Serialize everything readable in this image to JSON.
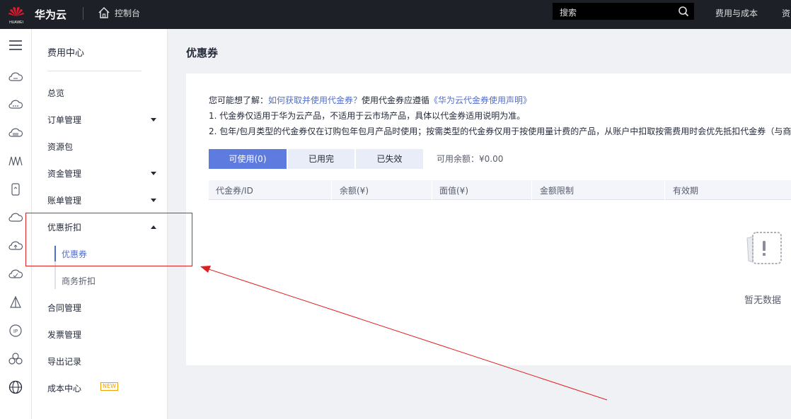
{
  "topbar": {
    "logo_text": "HUAWEI",
    "brand": "华为云",
    "console": "控制台",
    "search_placeholder": "搜索",
    "cost_link": "费用与成本",
    "more_link": "资"
  },
  "sidebar": {
    "title": "费用中心",
    "items": [
      {
        "label": "总览"
      },
      {
        "label": "订单管理",
        "expand": "down"
      },
      {
        "label": "资源包"
      },
      {
        "label": "资金管理",
        "expand": "down"
      },
      {
        "label": "账单管理",
        "expand": "down"
      },
      {
        "label": "优惠折扣",
        "expand": "up"
      },
      {
        "label": "合同管理"
      },
      {
        "label": "发票管理"
      },
      {
        "label": "导出记录"
      },
      {
        "label": "成本中心",
        "badge": "NEW"
      }
    ],
    "subitems": [
      {
        "label": "优惠券",
        "active": true
      },
      {
        "label": "商务折扣"
      }
    ]
  },
  "main": {
    "title": "优惠券",
    "tips": {
      "prefix": "您可能想了解：",
      "link1": "如何获取并使用代金券？",
      "mid": "使用代金券应遵循",
      "link2": "《华为云代金券使用声明》",
      "line1": "1. 代金券仅适用于华为云产品，不适用于云市场产品，具体以代金券适用说明为准。",
      "line2": "2. 包年/包月类型的代金券仅在订购包年包月产品时使用；按需类型的代金券仅用于按使用量计费的产品，从账户中扣取按需费用时会优先抵扣代金券（与商务"
    },
    "tabs": [
      {
        "label": "可使用(0)",
        "active": true
      },
      {
        "label": "已用完"
      },
      {
        "label": "已失效"
      }
    ],
    "balance": "可用余额：¥0.00",
    "columns": [
      "代金券/ID",
      "余额(¥)",
      "面值(¥)",
      "金额限制",
      "有效期"
    ],
    "empty_text": "暂无数据"
  },
  "colors": {
    "accent": "#5e7ce0",
    "link": "#526ecc",
    "annotation": "#e02020"
  }
}
